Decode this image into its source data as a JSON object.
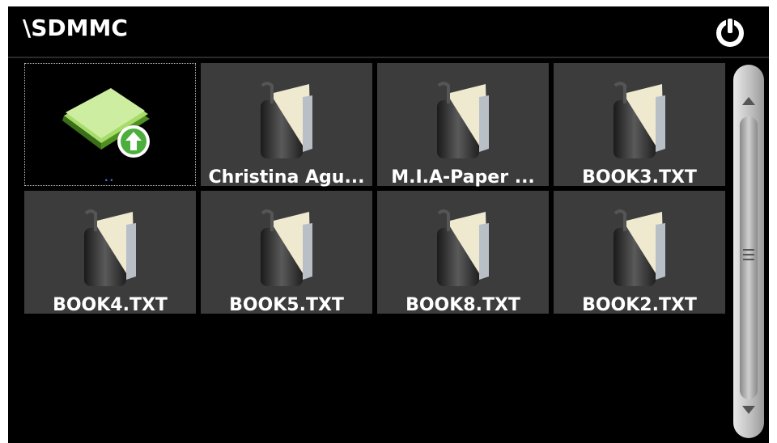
{
  "header": {
    "path": "\\SDMMC"
  },
  "tiles": [
    {
      "label": "..",
      "kind": "parent-folder"
    },
    {
      "label": "Christina Agu...",
      "kind": "book"
    },
    {
      "label": "M.I.A-Paper ...",
      "kind": "book"
    },
    {
      "label": "BOOK3.TXT",
      "kind": "book"
    },
    {
      "label": "BOOK4.TXT",
      "kind": "book"
    },
    {
      "label": "BOOK5.TXT",
      "kind": "book"
    },
    {
      "label": "BOOK8.TXT",
      "kind": "book"
    },
    {
      "label": "BOOK2.TXT",
      "kind": "book"
    }
  ],
  "colors": {
    "background": "#000000",
    "tile": "#3c3c3c",
    "text": "#ffffff",
    "folder_green": "#7bc043"
  },
  "icons": [
    "power-icon",
    "folder-up-icon",
    "book-icon",
    "scroll-up-arrow-icon",
    "scroll-down-arrow-icon"
  ]
}
